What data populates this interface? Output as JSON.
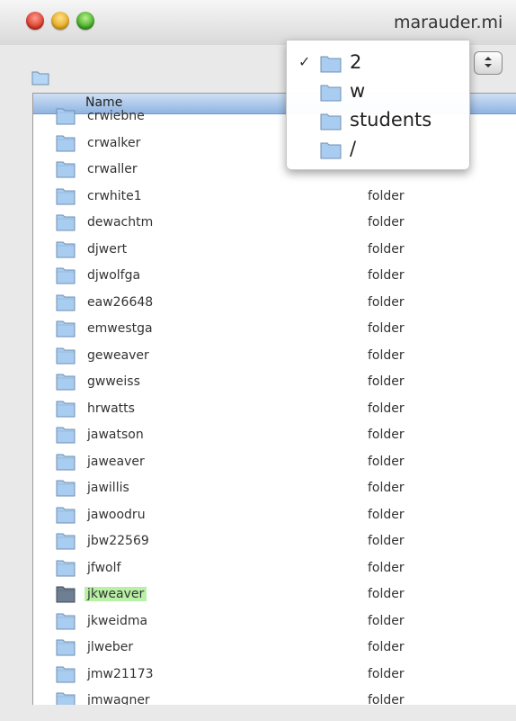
{
  "window": {
    "title": "marauder.mi"
  },
  "column_header": {
    "name": "Name"
  },
  "rows": [
    {
      "name": "crwiebne",
      "kind": ""
    },
    {
      "name": "crwalker",
      "kind": ""
    },
    {
      "name": "crwaller",
      "kind": ""
    },
    {
      "name": "crwhite1",
      "kind": "folder"
    },
    {
      "name": "dewachtm",
      "kind": "folder"
    },
    {
      "name": "djwert",
      "kind": "folder"
    },
    {
      "name": "djwolfga",
      "kind": "folder"
    },
    {
      "name": "eaw26648",
      "kind": "folder"
    },
    {
      "name": "emwestga",
      "kind": "folder"
    },
    {
      "name": "geweaver",
      "kind": "folder"
    },
    {
      "name": "gwweiss",
      "kind": "folder"
    },
    {
      "name": "hrwatts",
      "kind": "folder"
    },
    {
      "name": "jawatson",
      "kind": "folder"
    },
    {
      "name": "jaweaver",
      "kind": "folder"
    },
    {
      "name": "jawillis",
      "kind": "folder"
    },
    {
      "name": "jawoodru",
      "kind": "folder"
    },
    {
      "name": "jbw22569",
      "kind": "folder"
    },
    {
      "name": "jfwolf",
      "kind": "folder"
    },
    {
      "name": "jkweaver",
      "kind": "folder",
      "selected": true
    },
    {
      "name": "jkweidma",
      "kind": "folder"
    },
    {
      "name": "jlweber",
      "kind": "folder"
    },
    {
      "name": "jmw21173",
      "kind": "folder"
    },
    {
      "name": "jmwagner",
      "kind": "folder"
    }
  ],
  "path_menu": {
    "items": [
      {
        "label": "2",
        "checked": true
      },
      {
        "label": "w",
        "checked": false
      },
      {
        "label": "students",
        "checked": false
      },
      {
        "label": "/",
        "checked": false
      }
    ],
    "check_glyph": "✓"
  },
  "icons": {
    "folder": "folder-icon",
    "stepper": "stepper-arrows-icon"
  },
  "colors": {
    "folder_fill": "#a9cdf0",
    "folder_dark": "#6f7f93",
    "selection_highlight": "#b8f0a5",
    "header_gradient_top": "#cfe0f5",
    "header_gradient_bottom": "#8fb4e1"
  }
}
